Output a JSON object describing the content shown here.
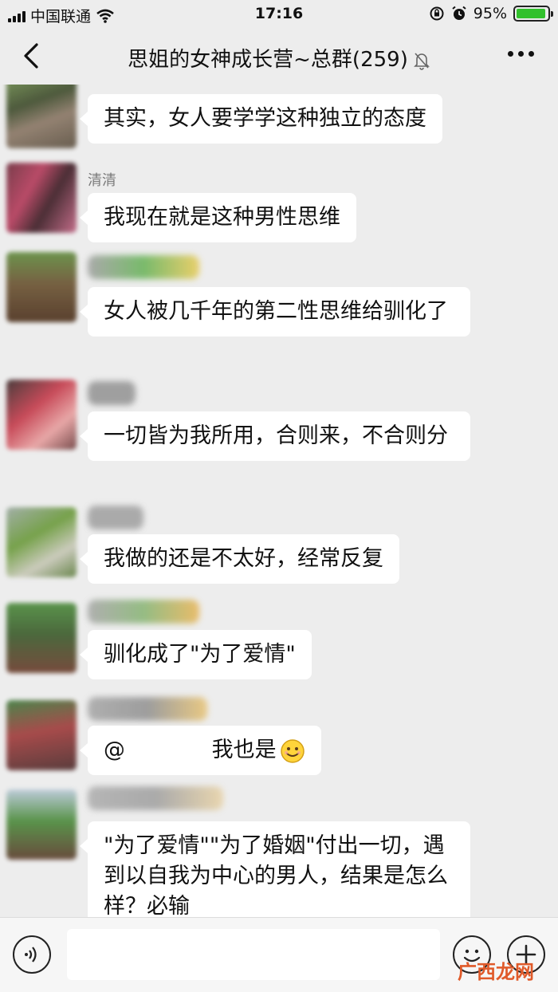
{
  "status_bar": {
    "carrier": "中国联通",
    "time": "17:16",
    "battery": "95%",
    "battery_level": 0.95,
    "battery_color": "#32c12c"
  },
  "nav": {
    "title": "思姐的女神成长营~总群(259)",
    "back_icon": "chevron-left-icon",
    "mute_icon": "bell-off-icon",
    "more_icon": "more-dots-icon"
  },
  "messages": [
    {
      "nickname": "",
      "text": "其实，女人要学学这种独立的态度"
    },
    {
      "nickname": "清清",
      "text": "我现在就是这种男性思维"
    },
    {
      "nickname": "",
      "text": "女人被几千年的第二性思维给驯化了"
    },
    {
      "nickname": "",
      "text": "一切皆为我所用，合则来，不合则分"
    },
    {
      "nickname": "",
      "text": "我做的还是不太好，经常反复"
    },
    {
      "nickname": "",
      "text": "驯化成了\"为了爱情\""
    },
    {
      "nickname": "",
      "mention_prefix": "@",
      "text": " 我也是",
      "emoji": "smile-emoji-icon"
    },
    {
      "nickname": "",
      "text": "\"为了爱情\"\"为了婚姻\"付出一切，遇到以自我为中心的男人，结果是怎么样？必输"
    }
  ],
  "input_bar": {
    "voice_icon": "voice-icon",
    "emoji_icon": "emoji-icon",
    "plus_icon": "plus-icon",
    "placeholder": ""
  },
  "watermark": "广西龙网"
}
